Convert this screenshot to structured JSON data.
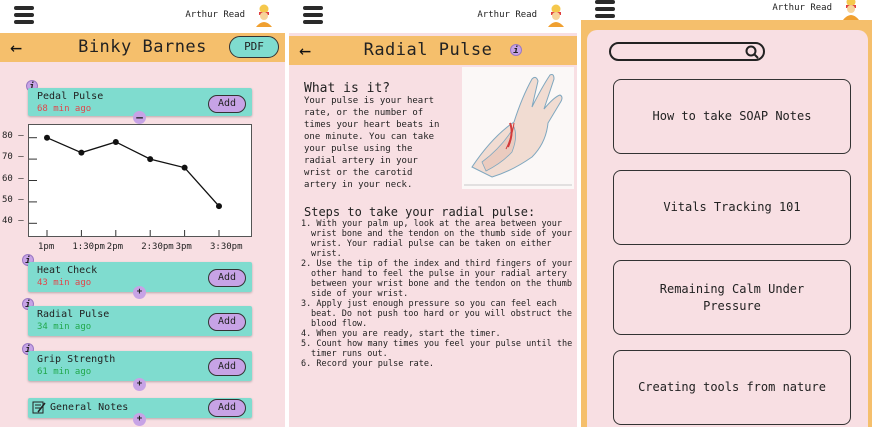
{
  "user": {
    "name": "Arthur Read"
  },
  "screen1": {
    "title": "Binky Barnes",
    "pdf_label": "PDF",
    "vitals": [
      {
        "name": "Pedal Pulse",
        "time": "68 min ago",
        "status": "red",
        "add": "Add"
      },
      {
        "name": "Heat Check",
        "time": "43 min ago",
        "status": "red",
        "add": "Add"
      },
      {
        "name": "Radial Pulse",
        "time": "34 min ago",
        "status": "green",
        "add": "Add"
      },
      {
        "name": "Grip Strength",
        "time": "61 min ago",
        "status": "green",
        "add": "Add"
      },
      {
        "name": "General Notes",
        "add": "Add"
      }
    ],
    "chart_data": {
      "type": "line",
      "x": [
        "1pm",
        "1:30pm",
        "2pm",
        "2:30pm",
        "3pm",
        "3:30pm"
      ],
      "values": [
        80,
        73,
        78,
        70,
        66,
        48
      ],
      "y_ticks": [
        "80",
        "70",
        "60",
        "50",
        "40"
      ],
      "ylim": [
        35,
        85
      ],
      "grid": false
    }
  },
  "screen2": {
    "title": "Radial Pulse",
    "what_heading": "What is it?",
    "what_body": "Your pulse is your heart rate, or the number of times your heart beats in one minute. You can take your pulse using the radial artery in your wrist or the carotid artery in your neck.",
    "steps_heading": "Steps to take your radial pulse:",
    "steps": [
      "1. With your palm up, look at the area between your wrist bone and the tendon on the thumb side of your wrist. Your radial pulse can be taken on either wrist.",
      "2. Use the tip of the index and third fingers of your other hand to feel the pulse in your radial artery between your wrist bone and the tendon on the thumb side of your wrist.",
      "3. Apply just enough pressure so you can feel each beat. Do not push too hard or you will obstruct the blood flow.",
      "4. When you are ready, start the timer.",
      "5. Count how many times you feel your pulse until the timer runs out.",
      "6. Record your pulse rate."
    ]
  },
  "screen3": {
    "courses": [
      "How to take SOAP Notes",
      "Vitals Tracking 101",
      "Remaining Calm Under Pressure",
      "Creating tools from nature"
    ]
  },
  "colors": {
    "orange": "#f5bf6c",
    "pink": "#f8dfe3",
    "teal": "#7fdccf",
    "purple": "#c7a3e6",
    "red": "#e0474c",
    "green": "#22a84d"
  }
}
